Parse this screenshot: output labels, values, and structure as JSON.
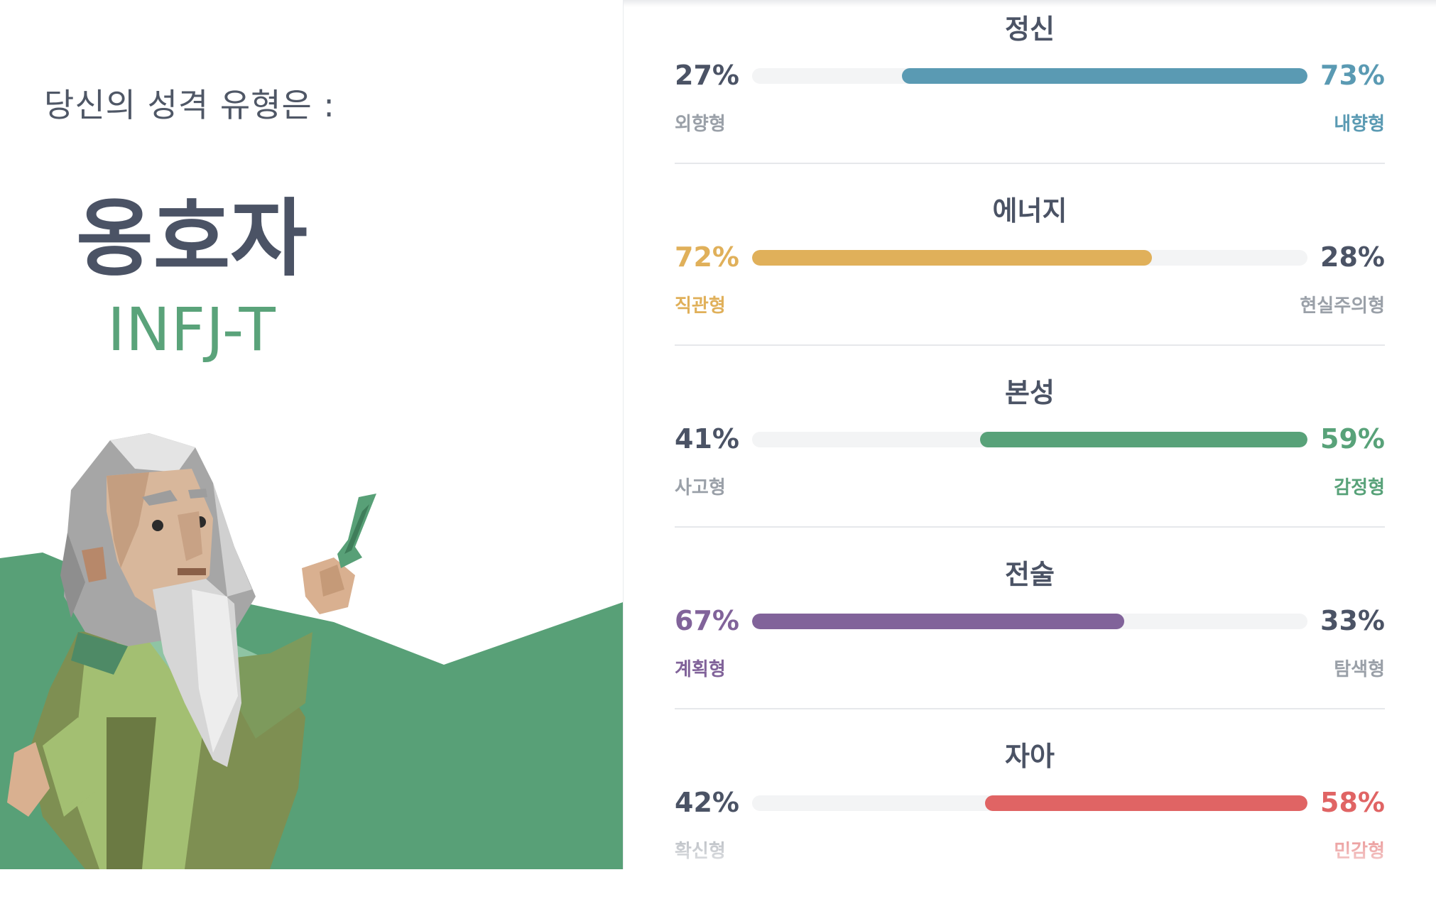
{
  "result": {
    "intro": "당신의 성격 유형은 :",
    "type_name": "옹호자",
    "type_code": "INFJ-T"
  },
  "colors": {
    "mind": "#5a9ab3",
    "energy": "#e0b05a",
    "nature": "#58a279",
    "tactics": "#81639a",
    "identity": "#e06464",
    "neutral_pct": "#4b5365",
    "neutral_label": "#9aa0a8",
    "mountain": "#58a077"
  },
  "traits": [
    {
      "title": "정신",
      "left_pct": "27%",
      "left_label": "외향형",
      "right_pct": "73%",
      "right_label": "내향형",
      "dominant": "right",
      "dominant_value": 73,
      "color": "#5a9ab3"
    },
    {
      "title": "에너지",
      "left_pct": "72%",
      "left_label": "직관형",
      "right_pct": "28%",
      "right_label": "현실주의형",
      "dominant": "left",
      "dominant_value": 72,
      "color": "#e0b05a"
    },
    {
      "title": "본성",
      "left_pct": "41%",
      "left_label": "사고형",
      "right_pct": "59%",
      "right_label": "감정형",
      "dominant": "right",
      "dominant_value": 59,
      "color": "#58a279"
    },
    {
      "title": "전술",
      "left_pct": "67%",
      "left_label": "계획형",
      "right_pct": "33%",
      "right_label": "탐색형",
      "dominant": "left",
      "dominant_value": 67,
      "color": "#81639a"
    },
    {
      "title": "자아",
      "left_pct": "42%",
      "left_label": "확신형",
      "right_pct": "58%",
      "right_label": "민감형",
      "dominant": "right",
      "dominant_value": 58,
      "color": "#e06464"
    }
  ]
}
